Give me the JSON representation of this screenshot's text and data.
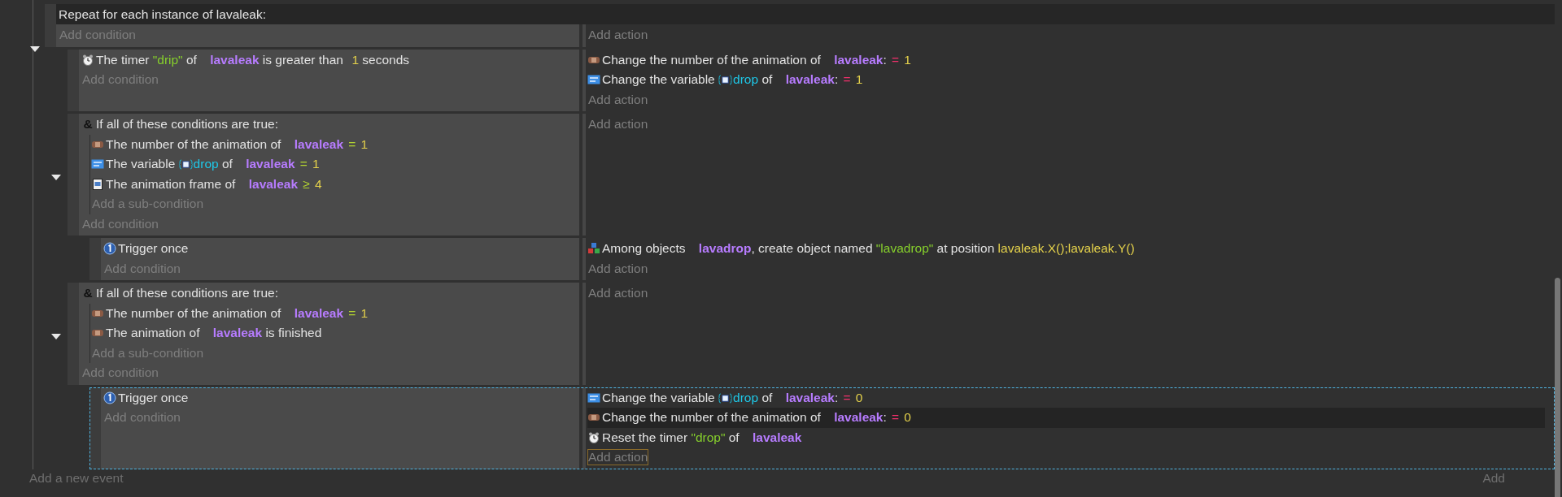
{
  "events": [
    {
      "kind": "repeat",
      "title": "Repeat for each instance of lavaleak:",
      "expanded": true,
      "selected": false,
      "add_condition": "Add condition",
      "add_action": "Add action",
      "add_action_focused": false,
      "children": [
        {
          "selected": false,
          "add_condition": "Add condition",
          "add_action": "Add action",
          "add_action_focused": false,
          "conditions": [
            {
              "kind": "timer",
              "segments": [
                {
                  "kind": "text",
                  "text": "The timer "
                },
                {
                  "kind": "string",
                  "text": "\"drip\""
                },
                {
                  "kind": "text",
                  "text": " of "
                },
                {
                  "kind": "object",
                  "text": "lavaleak"
                },
                {
                  "kind": "text",
                  "text": " is greater than "
                },
                {
                  "kind": "number",
                  "text": "1"
                },
                {
                  "kind": "text",
                  "text": " seconds"
                }
              ]
            }
          ],
          "actions": [
            {
              "kind": "animation",
              "hovered": false,
              "segments": [
                {
                  "kind": "text",
                  "text": "Change the number of the animation of "
                },
                {
                  "kind": "object",
                  "text": "lavaleak"
                },
                {
                  "kind": "text",
                  "text": ":"
                },
                {
                  "kind": "assign",
                  "text": "="
                },
                {
                  "kind": "number",
                  "text": "1"
                }
              ]
            },
            {
              "kind": "variable",
              "hovered": false,
              "segments": [
                {
                  "kind": "text",
                  "text": "Change the variable "
                },
                {
                  "kind": "variable",
                  "text": "drop"
                },
                {
                  "kind": "text",
                  "text": " of "
                },
                {
                  "kind": "object",
                  "text": "lavaleak"
                },
                {
                  "kind": "text",
                  "text": ":"
                },
                {
                  "kind": "assign",
                  "text": "="
                },
                {
                  "kind": "number",
                  "text": "1"
                }
              ]
            }
          ]
        },
        {
          "expanded": true,
          "selected": false,
          "add_condition": "Add condition",
          "add_action": "Add action",
          "add_action_focused": false,
          "conditions": [
            {
              "kind": "group",
              "symbol": "&",
              "title": "If all of these conditions are true:",
              "add_sub_condition": "Add a sub-condition",
              "children": [
                {
                  "kind": "animation",
                  "segments": [
                    {
                      "kind": "text",
                      "text": "The number of the animation of "
                    },
                    {
                      "kind": "object",
                      "text": "lavaleak"
                    },
                    {
                      "kind": "op",
                      "text": "="
                    },
                    {
                      "kind": "number",
                      "text": "1"
                    }
                  ]
                },
                {
                  "kind": "variable",
                  "segments": [
                    {
                      "kind": "text",
                      "text": "The variable "
                    },
                    {
                      "kind": "variable",
                      "text": "drop"
                    },
                    {
                      "kind": "text",
                      "text": " of "
                    },
                    {
                      "kind": "object",
                      "text": "lavaleak"
                    },
                    {
                      "kind": "op",
                      "text": "="
                    },
                    {
                      "kind": "number",
                      "text": "1"
                    }
                  ]
                },
                {
                  "kind": "frame",
                  "segments": [
                    {
                      "kind": "text",
                      "text": "The animation frame of "
                    },
                    {
                      "kind": "object",
                      "text": "lavaleak"
                    },
                    {
                      "kind": "op",
                      "text": "≥"
                    },
                    {
                      "kind": "number",
                      "text": "4"
                    }
                  ]
                }
              ]
            }
          ],
          "children": [
            {
              "selected": false,
              "add_condition": "Add condition",
              "add_action": "Add action",
              "add_action_focused": false,
              "conditions": [
                {
                  "kind": "trigger",
                  "segments": [
                    {
                      "kind": "text",
                      "text": "Trigger once"
                    }
                  ]
                }
              ],
              "actions": [
                {
                  "kind": "create",
                  "hovered": false,
                  "segments": [
                    {
                      "kind": "text",
                      "text": "Among objects "
                    },
                    {
                      "kind": "object",
                      "text": "lavadrop"
                    },
                    {
                      "kind": "text",
                      "text": ", create object named "
                    },
                    {
                      "kind": "string",
                      "text": "\"lavadrop\""
                    },
                    {
                      "kind": "text",
                      "text": " at position "
                    },
                    {
                      "kind": "expr",
                      "text": "lavaleak.X();lavaleak.Y()"
                    }
                  ]
                }
              ]
            }
          ]
        },
        {
          "expanded": true,
          "selected": false,
          "add_condition": "Add condition",
          "add_action": "Add action",
          "add_action_focused": false,
          "conditions": [
            {
              "kind": "group",
              "symbol": "&",
              "title": "If all of these conditions are true:",
              "add_sub_condition": "Add a sub-condition",
              "children": [
                {
                  "kind": "animation",
                  "segments": [
                    {
                      "kind": "text",
                      "text": "The number of the animation of "
                    },
                    {
                      "kind": "object",
                      "text": "lavaleak"
                    },
                    {
                      "kind": "op",
                      "text": "="
                    },
                    {
                      "kind": "number",
                      "text": "1"
                    }
                  ]
                },
                {
                  "kind": "animation",
                  "segments": [
                    {
                      "kind": "text",
                      "text": "The animation of "
                    },
                    {
                      "kind": "object",
                      "text": "lavaleak"
                    },
                    {
                      "kind": "text",
                      "text": " is finished"
                    }
                  ]
                }
              ]
            }
          ],
          "children": [
            {
              "selected": true,
              "add_condition": "Add condition",
              "add_action": "Add action",
              "add_action_focused": true,
              "conditions": [
                {
                  "kind": "trigger",
                  "segments": [
                    {
                      "kind": "text",
                      "text": "Trigger once"
                    }
                  ]
                }
              ],
              "actions": [
                {
                  "kind": "variable",
                  "hovered": false,
                  "segments": [
                    {
                      "kind": "text",
                      "text": "Change the variable "
                    },
                    {
                      "kind": "variable",
                      "text": "drop"
                    },
                    {
                      "kind": "text",
                      "text": " of "
                    },
                    {
                      "kind": "object",
                      "text": "lavaleak"
                    },
                    {
                      "kind": "text",
                      "text": ":"
                    },
                    {
                      "kind": "assign",
                      "text": "="
                    },
                    {
                      "kind": "number",
                      "text": "0"
                    }
                  ]
                },
                {
                  "kind": "animation",
                  "hovered": true,
                  "segments": [
                    {
                      "kind": "text",
                      "text": "Change the number of the animation of "
                    },
                    {
                      "kind": "object",
                      "text": "lavaleak"
                    },
                    {
                      "kind": "text",
                      "text": ":"
                    },
                    {
                      "kind": "assign",
                      "text": "="
                    },
                    {
                      "kind": "number",
                      "text": "0"
                    }
                  ]
                },
                {
                  "kind": "timer",
                  "hovered": false,
                  "segments": [
                    {
                      "kind": "text",
                      "text": "Reset the timer "
                    },
                    {
                      "kind": "string",
                      "text": "\"drop\""
                    },
                    {
                      "kind": "text",
                      "text": " of "
                    },
                    {
                      "kind": "object",
                      "text": "lavaleak"
                    }
                  ]
                }
              ]
            }
          ]
        }
      ]
    }
  ],
  "footer": {
    "add_event": "Add a new event",
    "add_other": "Add"
  }
}
